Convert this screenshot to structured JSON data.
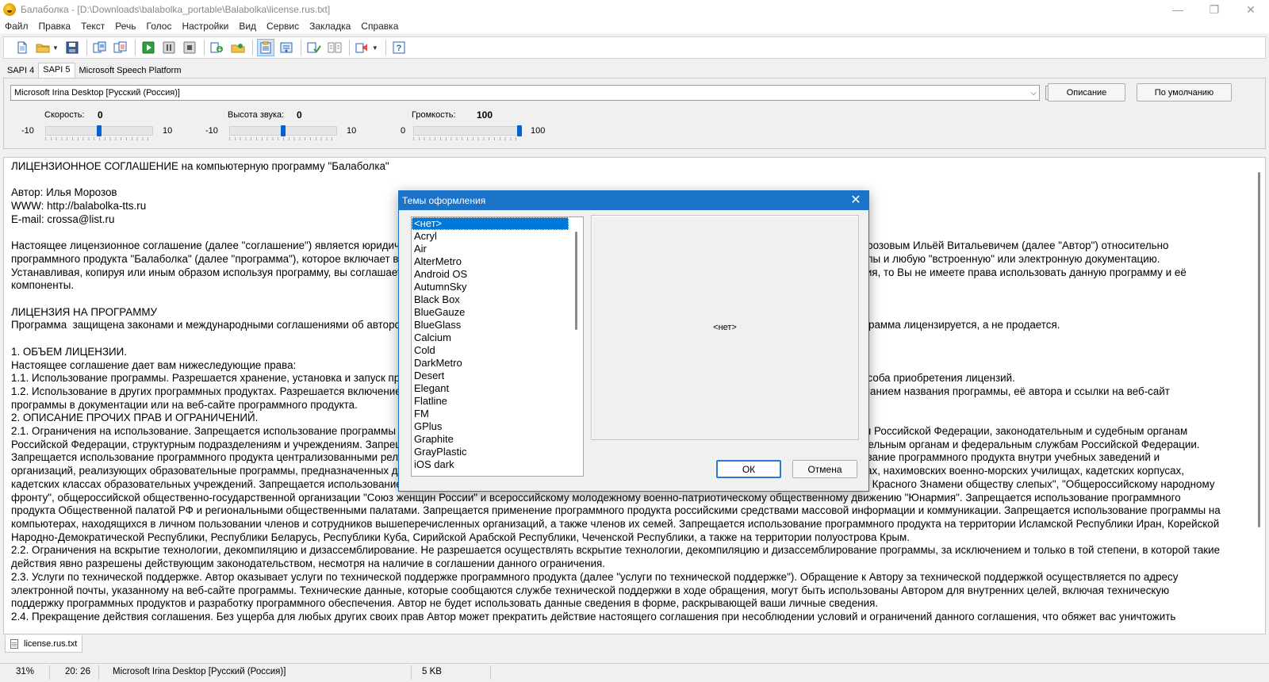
{
  "window": {
    "title": "Балаболка - [D:\\Downloads\\balabolka_portable\\Balabolka\\license.rus.txt]",
    "controls": {
      "minimize": "—",
      "restore": "❐",
      "close": "✕"
    }
  },
  "menu": [
    "Файл",
    "Правка",
    "Текст",
    "Речь",
    "Голос",
    "Настройки",
    "Вид",
    "Сервис",
    "Закладка",
    "Справка"
  ],
  "toolbar": {
    "buttons": [
      "new-file-icon",
      "open-folder-icon",
      "save-icon",
      "convert-icon",
      "batch-icon",
      "play-icon",
      "pause-icon",
      "stop-icon",
      "export-audio-icon",
      "open-audio-icon",
      "read-clipboard-icon",
      "settings-icon",
      "spell-check-icon",
      "compare-icon",
      "sound-icon",
      "help-icon"
    ],
    "active_button": "read-clipboard-icon"
  },
  "sapi_tabs": [
    "SAPI 4",
    "SAPI 5",
    "Microsoft Speech Platform"
  ],
  "sapi_active_tab": "SAPI 5",
  "voice": {
    "selected": "Microsoft Irina Desktop [Русский (Россия)]",
    "describe_button": "Описание",
    "default_button": "По умолчанию"
  },
  "sliders": {
    "rate": {
      "label": "Скорость:",
      "value": "0",
      "min": "-10",
      "max": "10",
      "position": 0.5
    },
    "pitch": {
      "label": "Высота звука:",
      "value": "0",
      "min": "-10",
      "max": "10",
      "position": 0.5
    },
    "volume": {
      "label": "Громкость:",
      "value": "100",
      "min": "0",
      "max": "100",
      "position": 1.0
    }
  },
  "document": {
    "text": "ЛИЦЕНЗИОННОЕ СОГЛАШЕНИЕ на компьютерную программу \"Балаболка\"\n\nАвтор: Илья Морозов\nWWW: http://balabolka-tts.ru\nE-mail: crossa@list.ru\n\nНастоящее лицензионное соглашение (далее \"соглашение\") является юридическим соглашением между физическим или юридическим лицом (далее \"Пользователь\") и Морозовым Ильёй Витальевичем (далее \"Автор\") относительно программного продукта \"Балаболка\" (далее \"программа\"), которое включает в себя программный продукт, представленное на веб-сайте \"Автора\", любые печатные материалы и любую \"встроенную\" или электронную документацию. Устанавливая, копируя или иным образом используя программу, вы соглашаетесь с условиями настоящего соглашения. Если Вы не принимаете условий данного соглашения, то Вы не имеете права использовать данную программу и её компоненты.\n\nЛИЦЕНЗИЯ НА ПРОГРАММУ\nПрограмма  защищена законами и международными соглашениями об авторских правах, а также другими законами и договорами в области интеллектуального права. Программа лицензируется, а не продается.\n\n1. ОБЪЕМ ЛИЦЕНЗИИ.\nНастоящее соглашение дает вам нижеследующие права:\n1.1. Использование программы. Разрешается хранение, установка и запуск программы на любом количестве компьютеров без внесения какой-либо оплаты или другого способа приобретения лицензий.\n1.2. Использование в других программных продуктах. Разрешается включение программы в состав других некоммерческих программных продуктов, с обязательным упоминанием названия программы, её автора и ссылки на веб-сайт программы в документации или на веб-сайте программного продукта.\n2. ОПИСАНИЕ ПРОЧИХ ПРАВ И ОГРАНИЧЕНИЙ.\n2.1. Ограничения на использование. Запрещается использование программы органами государственной власти Российской Федерации и органам местного самоуправления Российской Федерации, законодательным и судебным органам Российской Федерации, структурным подразделениям и учреждениям. Запрещается использование программного продукта на компьютерах, принадлежащих правоохранительным органам и федеральным службам Российской Федерации. Запрещается использование программного продукта централизованными религиозными объединениями и организациями в Российской Федерации. Запрещается использование программного продукта внутри учебных заведений и организаций, реализующих образовательные программы, предназначенных для обучения религии. Запрещается использование программы в суворовских военных училищах, нахимовских военно-морских училищах, кадетских корпусах, кадетских классах образовательных учреждений. Запрещается использование программного продукта на компьютерах, принадлежащих \"Всероссийскому ордена Трудового Красного Знамени обществу слепых\", \"Общероссийскому народному фронту\", общероссийской общественно-государственной организации \"Союз женщин России\" и всероссийскому молодежному военно-патриотическому общественному движению \"Юнармия\". Запрещается использование программного продукта Общественной палатой РФ и региональными общественными палатами. Запрещается применение программного продукта российскими средствами массовой информации и коммуникации. Запрещается использование программы на компьютерах, находящихся в личном пользовании членов и сотрудников вышеперечисленных организаций, а также членов их семей. Запрещается использование программного продукта на территории Исламской Республики Иран, Корейской Народно-Демократической Республики, Республики Беларусь, Республики Куба, Сирийской Арабской Республики, Чеченской Республики, а также на территории полуострова Крым.\n2.2. Ограничения на вскрытие технологии, декомпиляцию и дизассемблирование. Не разрешается осуществлять вскрытие технологии, декомпиляцию и дизассемблирование программы, за исключением и только в той степени, в которой такие действия явно разрешены действующим законодательством, несмотря на наличие в соглашении данного ограничения.\n2.3. Услуги по технической поддержке. Автор оказывает услуги по технической поддержке программного продукта (далее \"услуги по технической поддержке\"). Обращение к Автору за технической поддержкой осуществляется по адресу электронной почты, указанному на веб-сайте программы. Технические данные, которые сообщаются службе технической поддержки в ходе обращения, могут быть использованы Автором для внутренних целей, включая техническую поддержку программных продуктов и разработку программного обеспечения. Автор не будет использовать данные сведения в форме, раскрывающей ваши личные сведения.\n2.4. Прекращение действия соглашения. Без ущерба для любых других своих прав Автор может прекратить действие настоящего соглашения при несоблюдении условий и ограничений данного соглашения, что обяжет вас уничтожить"
  },
  "file_tab": "license.rus.txt",
  "status": {
    "percent": "31%",
    "position": "20:  26",
    "voice": "Microsoft Irina Desktop [Русский (Россия)]",
    "size": "5 KB"
  },
  "dialog": {
    "title": "Темы оформления",
    "themes": [
      "<нет>",
      "Acryl",
      "Air",
      "AlterMetro",
      "Android OS",
      "AutumnSky",
      "Black Box",
      "BlueGauze",
      "BlueGlass",
      "Calcium",
      "Cold",
      "DarkMetro",
      "Desert",
      "Elegant",
      "Flatline",
      "FM",
      "GPlus",
      "Graphite",
      "GrayPlastic",
      "iOS dark"
    ],
    "selected_theme": "<нет>",
    "preview_label": "<нет>",
    "ok": "ОК",
    "cancel": "Отмена"
  },
  "colors": {
    "accent": "#1a73c8",
    "selection": "#0078d7",
    "slider_thumb": "#0063d1"
  }
}
